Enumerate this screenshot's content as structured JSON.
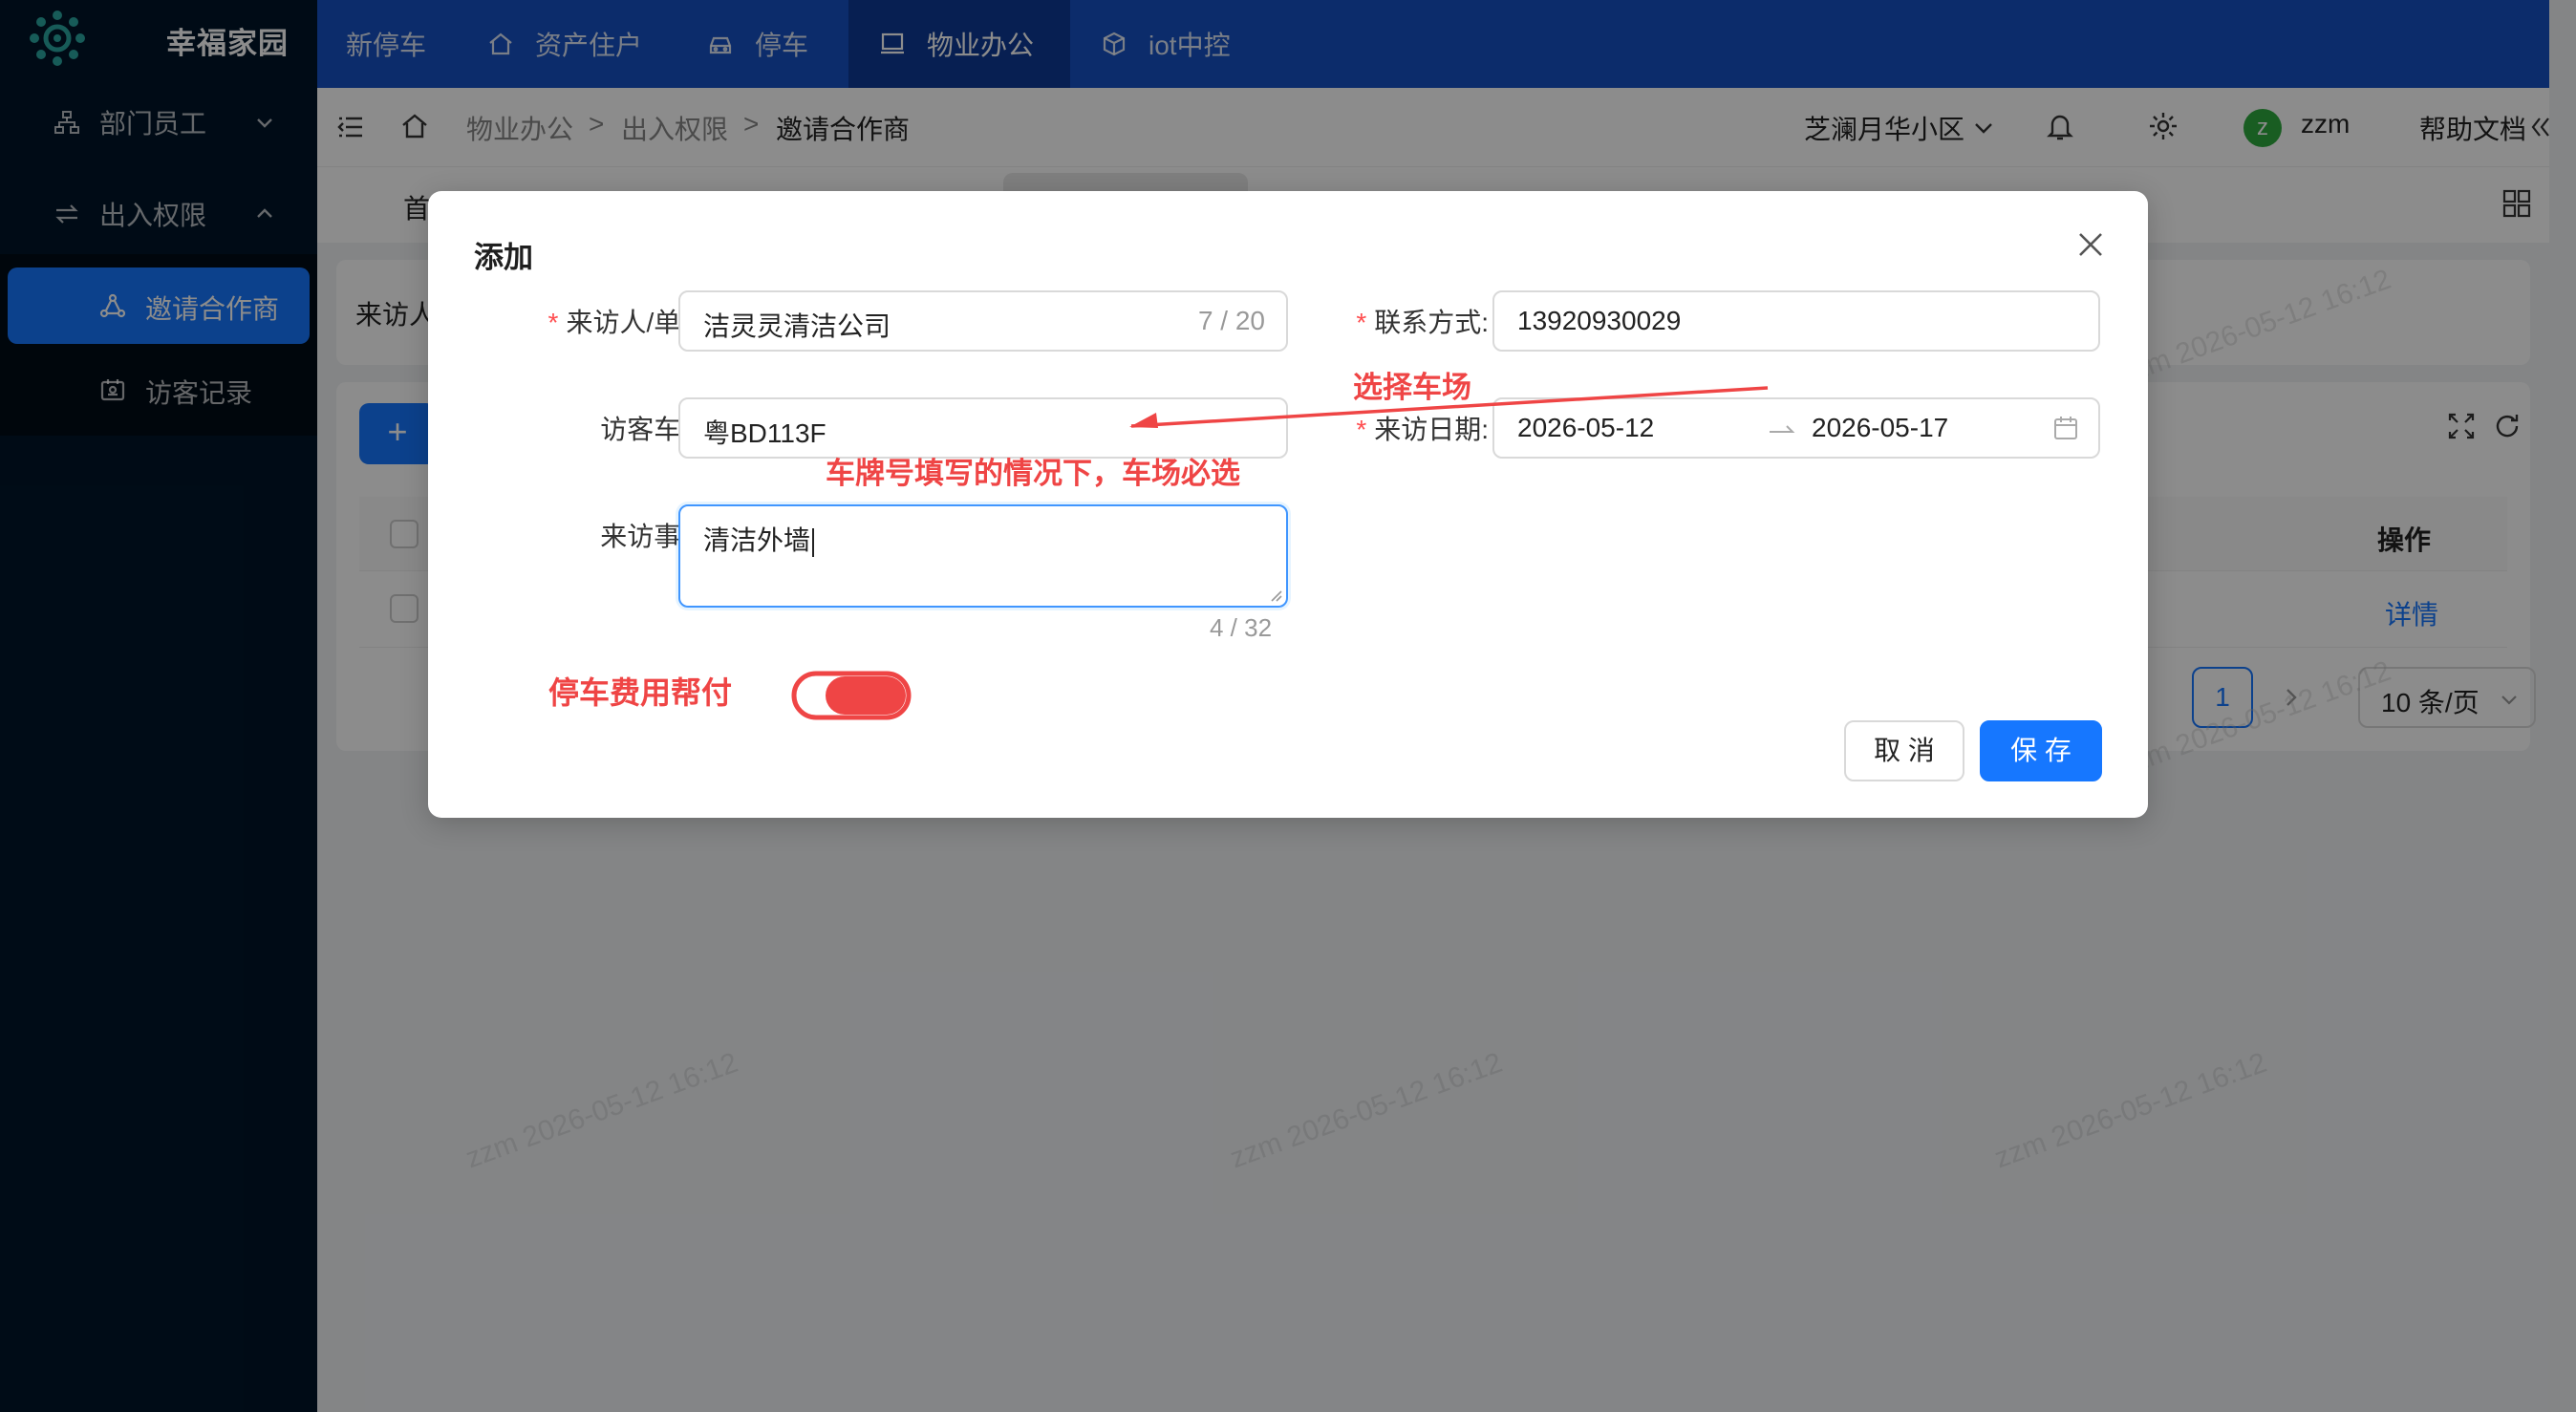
{
  "app": {
    "name": "幸福家园"
  },
  "top_nav": [
    {
      "label": "新停车"
    },
    {
      "label": "资产住户",
      "icon": "home-icon"
    },
    {
      "label": "停车",
      "icon": "car-icon"
    },
    {
      "label": "物业办公",
      "icon": "monitor-icon"
    },
    {
      "label": "iot中控",
      "icon": "cube-icon"
    }
  ],
  "sidebar": {
    "groups": [
      {
        "label": "部门员工",
        "icon": "org-chart-icon"
      },
      {
        "label": "出入权限",
        "icon": "swap-icon"
      }
    ],
    "items": [
      {
        "label": "邀请合作商",
        "icon": "share-nodes-icon"
      },
      {
        "label": "访客记录",
        "icon": "visitor-card-icon"
      }
    ]
  },
  "header": {
    "breadcrumb": [
      "物业办公",
      "出入权限",
      "邀请合作商"
    ],
    "separator": ">",
    "community": "芝澜月华小区",
    "user_initial": "z",
    "username": "zzm",
    "help": "帮助文档"
  },
  "page": {
    "tab_first": "首",
    "search_label_partial": "来访人",
    "table_header_action": "操作",
    "row_action": "详情",
    "page_number": "1",
    "page_size": "10 条/页",
    "add_symbol": "+"
  },
  "watermark": "zzm 2026-05-12 16:12",
  "modal": {
    "title": "添加",
    "fields": {
      "visitor": {
        "label": "来访人/单位:",
        "value": "洁灵灵清洁公司",
        "count": "7 / 20",
        "required": true
      },
      "contact": {
        "label": "联系方式:",
        "value": "13920930029",
        "required": true
      },
      "plate": {
        "label": "访客车牌:",
        "value": "粤BD113F"
      },
      "date": {
        "label": "来访日期:",
        "start": "2026-05-12",
        "end": "2026-05-17",
        "required": true
      },
      "reason": {
        "label": "来访事由:",
        "value": "清洁外墙",
        "count": "4 / 32"
      }
    },
    "parking_fee_label": "停车费用帮付",
    "cancel_label": "取 消",
    "save_label": "保 存",
    "required_mark": "*"
  },
  "annotations": {
    "choose_lot": "选择车场",
    "plate_note": "车牌号填写的情况下，车场必选"
  },
  "colors": {
    "brand_blue": "#1677ff",
    "annotation_red": "#ef4545",
    "topbar": "#1650c4",
    "sidebar": "#001529"
  }
}
